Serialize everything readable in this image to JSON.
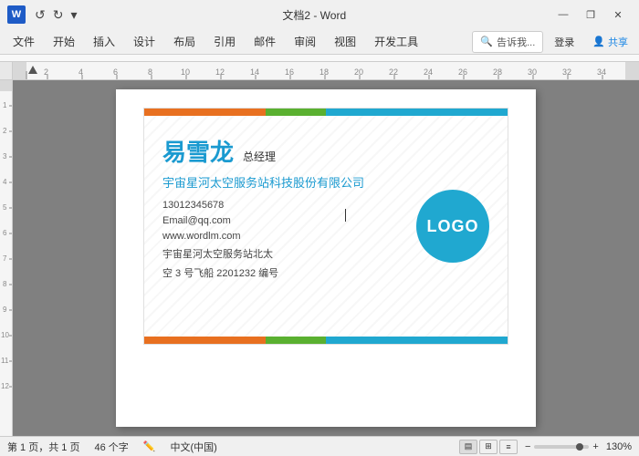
{
  "titlebar": {
    "title": "文档2 - Word",
    "app_icon": "W",
    "undo_icon": "↺",
    "redo_icon": "↻",
    "minimize": "—",
    "restore": "❐",
    "close": "✕"
  },
  "menubar": {
    "items": [
      "文件",
      "开始",
      "插入",
      "设计",
      "布局",
      "引用",
      "邮件",
      "审阅",
      "视图",
      "开发工具"
    ],
    "search_placeholder": "告诉我...",
    "login": "登录",
    "share": "共享"
  },
  "card": {
    "name": "易雪龙",
    "job_title": "总经理",
    "company": "宇宙星河太空服务站科技股份有限公司",
    "phone": "13012345678",
    "email": "Email@qq.com",
    "website": "www.wordlm.com",
    "address1": "宇宙星河太空服务站北太",
    "address2": "空 3 号飞船 2201232 编号",
    "logo_text": "LOGO"
  },
  "statusbar": {
    "page_info": "第 1 页，共 1 页",
    "word_count": "46 个字",
    "lang": "中文(中国)",
    "zoom": "130%",
    "zoom_minus": "−",
    "zoom_plus": "+"
  }
}
